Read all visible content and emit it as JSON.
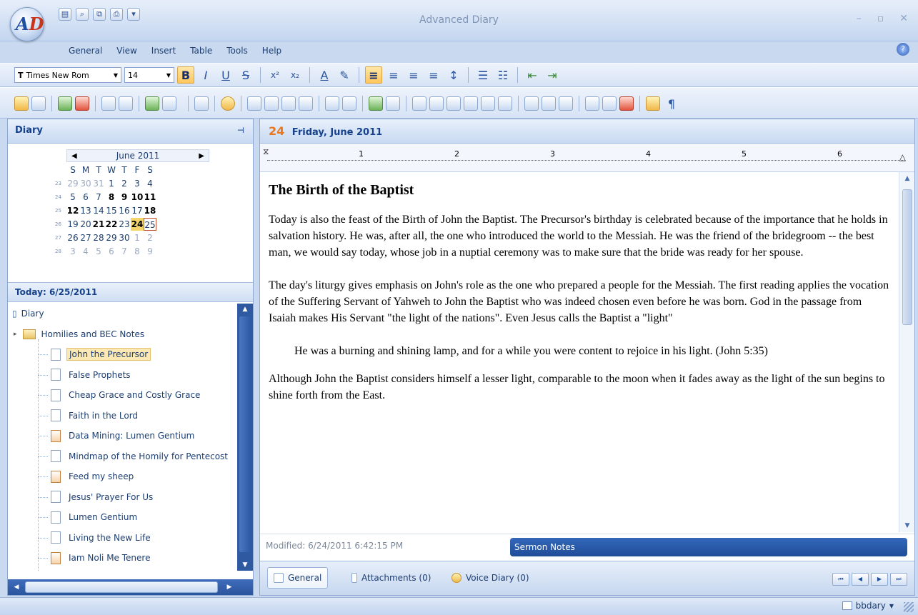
{
  "app": {
    "title": "Advanced Diary",
    "logo_text": "AD"
  },
  "menu": [
    "General",
    "View",
    "Insert",
    "Table",
    "Tools",
    "Help"
  ],
  "format_toolbar": {
    "font_name": "Times New Rom",
    "font_size": "14"
  },
  "left_pane": {
    "title": "Diary",
    "calendar": {
      "month_label": "June 2011",
      "weekdays": [
        "S",
        "M",
        "T",
        "W",
        "T",
        "F",
        "S"
      ],
      "weeks": [
        {
          "wk": "23",
          "days": [
            "29",
            "30",
            "31",
            "1",
            "2",
            "3",
            "4"
          ]
        },
        {
          "wk": "24",
          "days": [
            "5",
            "6",
            "7",
            "8",
            "9",
            "10",
            "11"
          ]
        },
        {
          "wk": "25",
          "days": [
            "12",
            "13",
            "14",
            "15",
            "16",
            "17",
            "18"
          ]
        },
        {
          "wk": "26",
          "days": [
            "19",
            "20",
            "21",
            "22",
            "23",
            "24",
            "25"
          ]
        },
        {
          "wk": "27",
          "days": [
            "26",
            "27",
            "28",
            "29",
            "30",
            "1",
            "2"
          ]
        },
        {
          "wk": "28",
          "days": [
            "3",
            "4",
            "5",
            "6",
            "7",
            "8",
            "9"
          ]
        }
      ],
      "today": "24",
      "selected": "25"
    },
    "today_label": "Today: 6/25/2011",
    "tree": {
      "root": "Diary",
      "folder": "Homilies and BEC Notes",
      "items": [
        "John the Precursor",
        "False Prophets",
        "Cheap Grace and Costly Grace",
        "Faith in the Lord",
        "Data Mining: Lumen Gentium",
        "Mindmap of the Homily for Pentecost",
        "Feed my sheep",
        "Jesus' Prayer For Us",
        "Lumen Gentium",
        "Living the New Life",
        "Iam Noli Me Tenere"
      ]
    }
  },
  "entry": {
    "date_number": "24",
    "date_label": "Friday, June 2011",
    "ruler_marks": [
      "1",
      "2",
      "3",
      "4",
      "5",
      "6"
    ],
    "heading": "The Birth of the Baptist",
    "paragraphs": [
      "Today is also the feast of the Birth of John the Baptist.  The Precursor's birthday is celebrated because of the importance that he holds in salvation history.  He was, after all, the one who introduced the world to the Messiah.  He was the friend of the bridegroom -- the best man, we would say today, whose job in a nuptial ceremony was to make sure that the bride was ready for her spouse.",
      "The day's liturgy gives emphasis on John's role as the one who prepared a people for the Messiah.  The first reading applies the vocation of the Suffering Servant of Yahweh to John the Baptist who was indeed chosen even before he was born.  God in the passage from Isaiah makes His Servant \"the light of the nations\".  Even Jesus calls the Baptist a \"light\""
    ],
    "quote": "He was a burning and shining lamp, and for a while you were content to rejoice in his light.  (John 5:35)",
    "closing": "Although John the Baptist considers himself a lesser light, comparable to the moon when it fades away as the light of the sun begins to shine forth from the East.",
    "modified": "Modified: 6/24/2011 6:42:15 PM",
    "category": "Sermon Notes"
  },
  "bottom_tabs": {
    "general": "General",
    "attachments": "Attachments (0)",
    "voice": "Voice Diary (0)"
  },
  "status": {
    "user": "bbdary"
  }
}
